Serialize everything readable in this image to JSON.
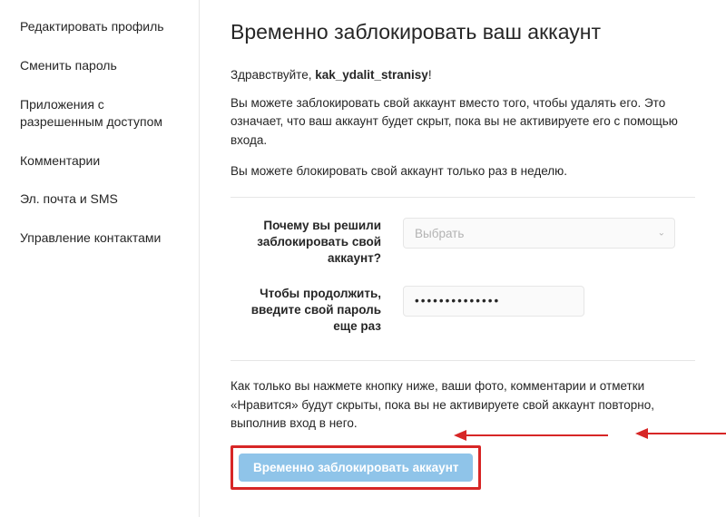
{
  "sidebar": {
    "items": [
      {
        "label": "Редактировать профиль"
      },
      {
        "label": "Сменить пароль"
      },
      {
        "label": "Приложения с разрешенным доступом"
      },
      {
        "label": "Комментарии"
      },
      {
        "label": "Эл. почта и SMS"
      },
      {
        "label": "Управление контактами"
      }
    ]
  },
  "main": {
    "title": "Временно заблокировать ваш аккаунт",
    "greet_prefix": "Здравствуйте, ",
    "greet_user": "kak_ydalit_stranisy",
    "greet_suffix": "!",
    "para1": "Вы можете заблокировать свой аккаунт вместо того, чтобы удалять его. Это означает, что ваш аккаунт будет скрыт, пока вы не активируете его с помощью входа.",
    "para2": "Вы можете блокировать свой аккаунт только раз в неделю.",
    "reason_label": "Почему вы решили заблокировать свой аккаунт?",
    "reason_placeholder": "Выбрать",
    "password_label": "Чтобы продолжить, введите свой пароль еще раз",
    "password_value": "••••••••••••••",
    "confirm_para": "Как только вы нажмете кнопку ниже, ваши фото, комментарии и отметки «Нравится» будут скрыты, пока вы не активируете свой аккаунт повторно, выполнив вход в него.",
    "button_label": "Временно заблокировать аккаунт"
  },
  "colors": {
    "button": "#8fc4e9",
    "highlight": "#d72626"
  }
}
